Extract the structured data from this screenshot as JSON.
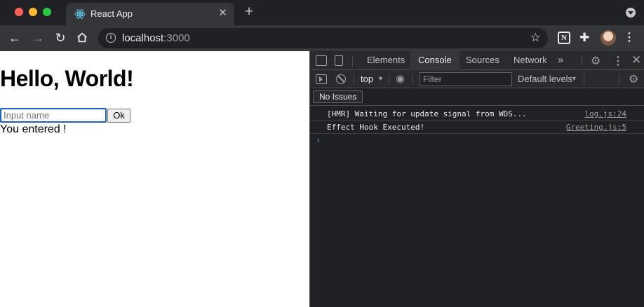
{
  "browser": {
    "tab_title": "React App",
    "url_host": "localhost",
    "url_port": ":3000"
  },
  "page": {
    "heading": "Hello, World!",
    "input_placeholder": "Input name",
    "ok_label": "Ok",
    "entered_text": "You entered !"
  },
  "devtools": {
    "tabs": [
      "Elements",
      "Console",
      "Sources",
      "Network"
    ],
    "active_tab": "Console",
    "context": "top",
    "filter_placeholder": "Filter",
    "levels": "Default levels",
    "issues_label": "No Issues",
    "messages": [
      {
        "text": "[HMR] Waiting for update signal from WDS...",
        "source": "log.js:24"
      },
      {
        "text": "Effect Hook Executed!",
        "source": "Greeting.js:5"
      }
    ]
  },
  "colors": {
    "focus_ring": "#1a62c9",
    "prompt_caret": "#4f9df3"
  }
}
